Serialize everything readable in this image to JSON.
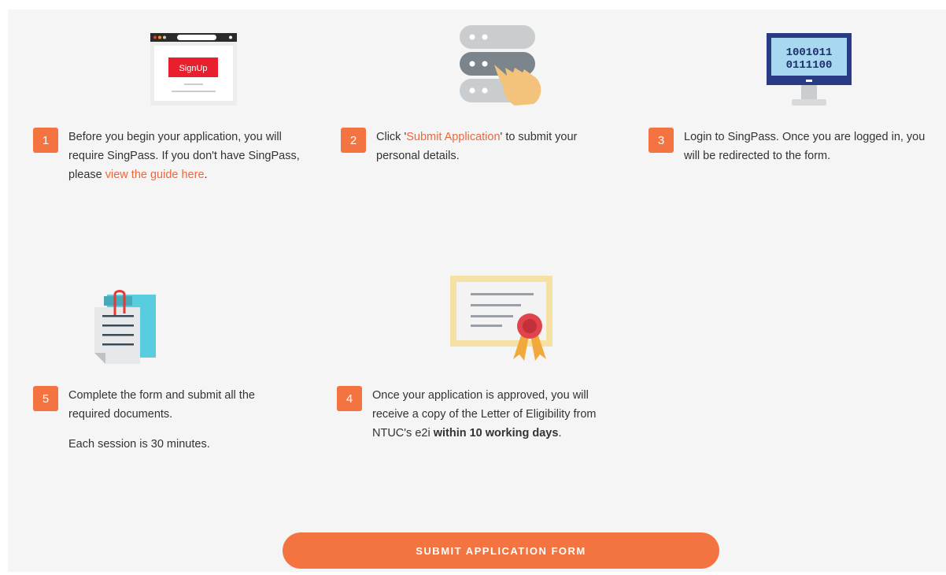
{
  "steps": [
    {
      "number": "1",
      "lines": {
        "a": "Before you begin your application, you will require SingPass. If you don't have SingPass, please ",
        "link": "view the guide here",
        "b": "."
      }
    },
    {
      "number": "2",
      "lines": {
        "a": "Click '",
        "link": "Submit Application",
        "b": "' to submit your personal details."
      }
    },
    {
      "number": "3",
      "lines": {
        "a": "Login to SingPass. Once you are logged in, you will be redirected to the form."
      }
    },
    {
      "number": "5",
      "lines": {
        "a": "Complete the form and submit all the required documents.",
        "note": "Each session is 30 minutes."
      }
    },
    {
      "number": "4",
      "lines": {
        "a": "Once your application is approved, you will receive a copy of the Letter of Eligibility from NTUC's e2i ",
        "bold": "within 10 working days",
        "b": "."
      }
    }
  ],
  "illustrations": {
    "browser_button": "SignUp",
    "monitor_binary_1": "1001011",
    "monitor_binary_2": "0111100"
  },
  "submit_button": "SUBMIT APPLICATION FORM",
  "colors": {
    "accent": "#f47441",
    "link": "#f0663c",
    "background": "#f5f5f5"
  },
  "icons": [
    "browser-signup-icon",
    "server-hand-icon",
    "monitor-binary-icon",
    "clipboard-documents-icon",
    "certificate-icon"
  ]
}
